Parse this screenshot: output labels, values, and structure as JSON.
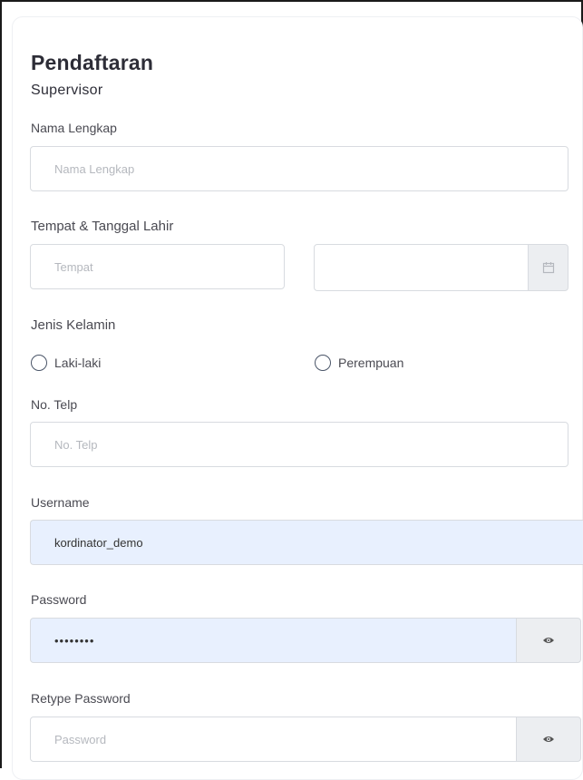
{
  "form": {
    "title": "Pendaftaran",
    "subtitle": "Supervisor",
    "nama": {
      "label": "Nama Lengkap",
      "placeholder": "Nama Lengkap",
      "value": ""
    },
    "ttl": {
      "label": "Tempat & Tanggal Lahir",
      "tempat_placeholder": "Tempat",
      "tanggal_value": ""
    },
    "gender": {
      "label": "Jenis Kelamin",
      "options": [
        "Laki-laki",
        "Perempuan"
      ]
    },
    "telp": {
      "label": "No. Telp",
      "placeholder": "No. Telp",
      "value": ""
    },
    "username": {
      "label": "Username",
      "value": "kordinator_demo"
    },
    "password": {
      "label": "Password",
      "value": "••••••••"
    },
    "retype": {
      "label": "Retype Password",
      "placeholder": "Password",
      "value": ""
    }
  },
  "icons": {
    "calendar": "calendar-icon",
    "eye": "eye-icon",
    "radio": "radio-circle"
  },
  "colors": {
    "autofill_bg": "#e8f0fe",
    "addon_bg": "#eceef1",
    "border": "#d8dbe0"
  }
}
